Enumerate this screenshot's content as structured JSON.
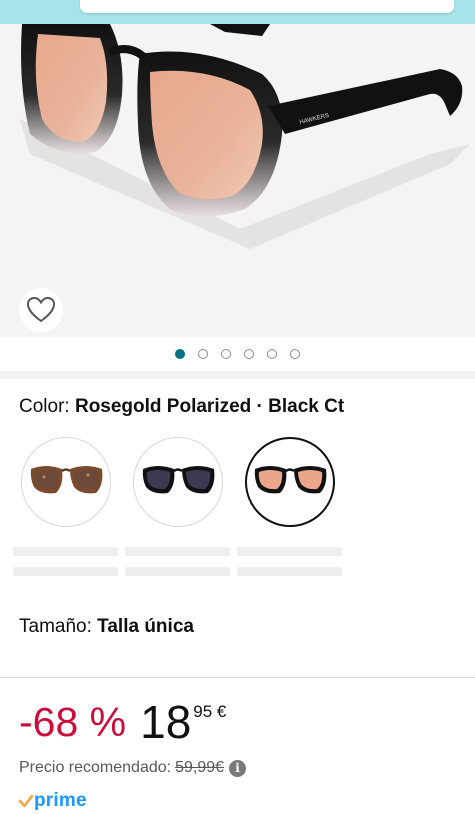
{
  "product": {
    "brand_on_temple": "HAWKERS",
    "image_count": 6,
    "active_image_index": 0
  },
  "variations": {
    "color_label": "Color:",
    "color_value": "Rosegold Polarized · Black Ct",
    "swatches": [
      {
        "name": "tortoise",
        "lens": "#6b4a3a",
        "frame": "#7a4a2c",
        "selected": false
      },
      {
        "name": "black-grey",
        "lens": "#3c3a52",
        "frame": "#111111",
        "selected": false
      },
      {
        "name": "rosegold-black-ct",
        "lens": "#e9a68a",
        "frame": "#111111",
        "selected": true
      }
    ],
    "size_label": "Tamaño:",
    "size_value": "Talla única"
  },
  "pricing": {
    "discount": "-68 %",
    "price_whole": "18",
    "price_fraction": "95 €",
    "recommended_label": "Precio recomendado:",
    "recommended_price": "59,99€",
    "info_glyph": "i"
  },
  "prime": {
    "check": "✓",
    "label": "prime"
  },
  "colors": {
    "accent_dot": "#007185",
    "discount_red": "#cc0c39",
    "prime_blue": "#1a98ff",
    "prime_check": "#f3a847"
  }
}
